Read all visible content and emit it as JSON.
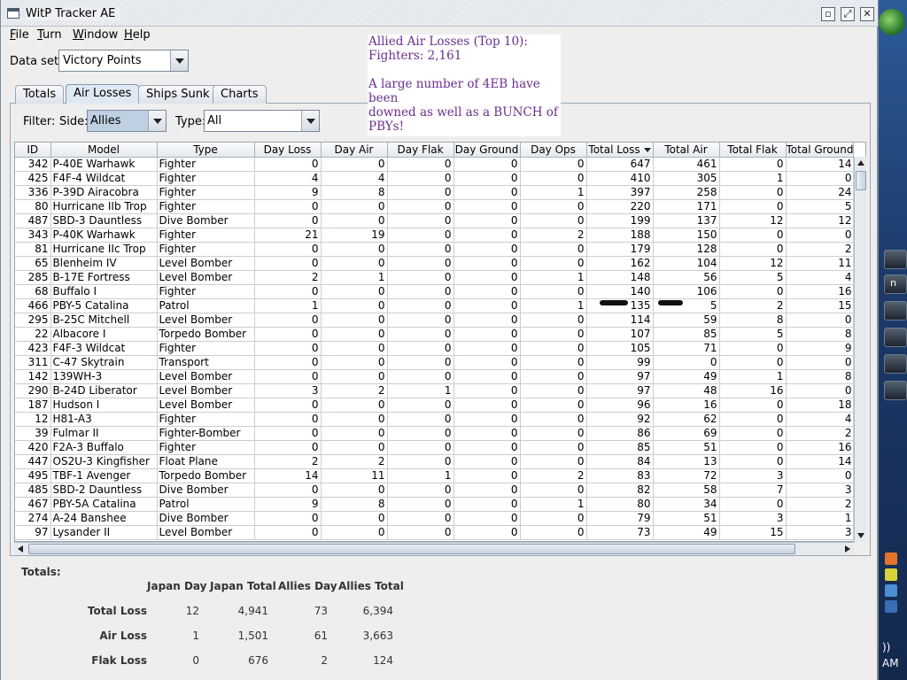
{
  "window": {
    "title": "WitP Tracker AE"
  },
  "menu": [
    {
      "label": "File",
      "underline": "F",
      "rest": "ile"
    },
    {
      "label": "Turn",
      "underline": "T",
      "rest": "urn"
    },
    {
      "label": "Window",
      "underline": "W",
      "rest": "indow"
    },
    {
      "label": "Help",
      "underline": "H",
      "rest": "elp"
    }
  ],
  "dataset": {
    "label": "Data set:",
    "value": "Victory Points"
  },
  "note": {
    "line1": "Allied Air Losses (Top 10):",
    "line2": "Fighters:  2,161",
    "line3": "A large number of 4EB have been",
    "line4": "downed as well as a BUNCH of",
    "line5": "PBYs!"
  },
  "tabs": [
    "Totals",
    "Air Losses",
    "Ships Sunk",
    "Charts"
  ],
  "active_tab": "Air Losses",
  "filter": {
    "label": "Filter:",
    "side_label": "Side:",
    "side_value": "Allies",
    "type_label": "Type:",
    "type_value": "All"
  },
  "table": {
    "columns": [
      "ID",
      "Model",
      "Type",
      "Day Loss",
      "Day Air",
      "Day Flak",
      "Day Ground",
      "Day Ops",
      "Total Loss",
      "Total Air",
      "Total Flak",
      "Total Ground"
    ],
    "sorted_column": "Total Loss",
    "rows": [
      [
        "342",
        "P-40E Warhawk",
        "Fighter",
        "0",
        "0",
        "0",
        "0",
        "0",
        "647",
        "461",
        "0",
        "14"
      ],
      [
        "425",
        "F4F-4 Wildcat",
        "Fighter",
        "4",
        "4",
        "0",
        "0",
        "0",
        "410",
        "305",
        "1",
        "0"
      ],
      [
        "336",
        "P-39D Airacobra",
        "Fighter",
        "9",
        "8",
        "0",
        "0",
        "1",
        "397",
        "258",
        "0",
        "24"
      ],
      [
        "80",
        "Hurricane IIb Trop",
        "Fighter",
        "0",
        "0",
        "0",
        "0",
        "0",
        "220",
        "171",
        "0",
        "5"
      ],
      [
        "487",
        "SBD-3 Dauntless",
        "Dive Bomber",
        "0",
        "0",
        "0",
        "0",
        "0",
        "199",
        "137",
        "12",
        "12"
      ],
      [
        "343",
        "P-40K Warhawk",
        "Fighter",
        "21",
        "19",
        "0",
        "0",
        "2",
        "188",
        "150",
        "0",
        "0"
      ],
      [
        "81",
        "Hurricane IIc Trop",
        "Fighter",
        "0",
        "0",
        "0",
        "0",
        "0",
        "179",
        "128",
        "0",
        "2"
      ],
      [
        "65",
        "Blenheim IV",
        "Level Bomber",
        "0",
        "0",
        "0",
        "0",
        "0",
        "162",
        "104",
        "12",
        "11"
      ],
      [
        "285",
        "B-17E Fortress",
        "Level Bomber",
        "2",
        "1",
        "0",
        "0",
        "1",
        "148",
        "56",
        "5",
        "4"
      ],
      [
        "68",
        "Buffalo I",
        "Fighter",
        "0",
        "0",
        "0",
        "0",
        "0",
        "140",
        "106",
        "0",
        "16"
      ],
      [
        "466",
        "PBY-5 Catalina",
        "Patrol",
        "1",
        "0",
        "0",
        "0",
        "1",
        "135",
        "5",
        "2",
        "15"
      ],
      [
        "295",
        "B-25C Mitchell",
        "Level Bomber",
        "0",
        "0",
        "0",
        "0",
        "0",
        "114",
        "59",
        "8",
        "0"
      ],
      [
        "22",
        "Albacore I",
        "Torpedo Bomber",
        "0",
        "0",
        "0",
        "0",
        "0",
        "107",
        "85",
        "5",
        "8"
      ],
      [
        "423",
        "F4F-3 Wildcat",
        "Fighter",
        "0",
        "0",
        "0",
        "0",
        "0",
        "105",
        "71",
        "0",
        "9"
      ],
      [
        "311",
        "C-47 Skytrain",
        "Transport",
        "0",
        "0",
        "0",
        "0",
        "0",
        "99",
        "0",
        "0",
        "0"
      ],
      [
        "142",
        "139WH-3",
        "Level Bomber",
        "0",
        "0",
        "0",
        "0",
        "0",
        "97",
        "49",
        "1",
        "8"
      ],
      [
        "290",
        "B-24D Liberator",
        "Level Bomber",
        "3",
        "2",
        "1",
        "0",
        "0",
        "97",
        "48",
        "16",
        "0"
      ],
      [
        "187",
        "Hudson I",
        "Level Bomber",
        "0",
        "0",
        "0",
        "0",
        "0",
        "96",
        "16",
        "0",
        "18"
      ],
      [
        "12",
        "H81-A3",
        "Fighter",
        "0",
        "0",
        "0",
        "0",
        "0",
        "92",
        "62",
        "0",
        "4"
      ],
      [
        "39",
        "Fulmar II",
        "Fighter-Bomber",
        "0",
        "0",
        "0",
        "0",
        "0",
        "86",
        "69",
        "0",
        "2"
      ],
      [
        "420",
        "F2A-3 Buffalo",
        "Fighter",
        "0",
        "0",
        "0",
        "0",
        "0",
        "85",
        "51",
        "0",
        "16"
      ],
      [
        "447",
        "OS2U-3 Kingfisher",
        "Float Plane",
        "2",
        "2",
        "0",
        "0",
        "0",
        "84",
        "13",
        "0",
        "14"
      ],
      [
        "495",
        "TBF-1 Avenger",
        "Torpedo Bomber",
        "14",
        "11",
        "1",
        "0",
        "2",
        "83",
        "72",
        "3",
        "0"
      ],
      [
        "485",
        "SBD-2 Dauntless",
        "Dive Bomber",
        "0",
        "0",
        "0",
        "0",
        "0",
        "82",
        "58",
        "7",
        "3"
      ],
      [
        "467",
        "PBY-5A Catalina",
        "Patrol",
        "9",
        "8",
        "0",
        "0",
        "1",
        "80",
        "34",
        "0",
        "2"
      ],
      [
        "274",
        "A-24 Banshee",
        "Dive Bomber",
        "0",
        "0",
        "0",
        "0",
        "0",
        "79",
        "51",
        "3",
        "1"
      ],
      [
        "97",
        "Lysander II",
        "Level Bomber",
        "0",
        "0",
        "0",
        "0",
        "0",
        "73",
        "49",
        "15",
        "3"
      ]
    ]
  },
  "totals": {
    "label": "Totals:",
    "headers": [
      "Japan Day",
      "Japan Total",
      "Allies Day",
      "Allies Total"
    ],
    "rows": [
      {
        "label": "Total Loss",
        "values": [
          "12",
          "4,941",
          "73",
          "6,394"
        ]
      },
      {
        "label": "Air Loss",
        "values": [
          "1",
          "1,501",
          "61",
          "3,663"
        ]
      },
      {
        "label": "Flak Loss",
        "values": [
          "0",
          "676",
          "2",
          "124"
        ]
      }
    ]
  },
  "taskbar": {
    "tray_text_1": "))",
    "tray_text_2": "AM"
  },
  "colors": {
    "note_text": "#6b2f8e",
    "tab_active": "#dfe9f4",
    "side_select_bg": "#bfd0e3"
  }
}
